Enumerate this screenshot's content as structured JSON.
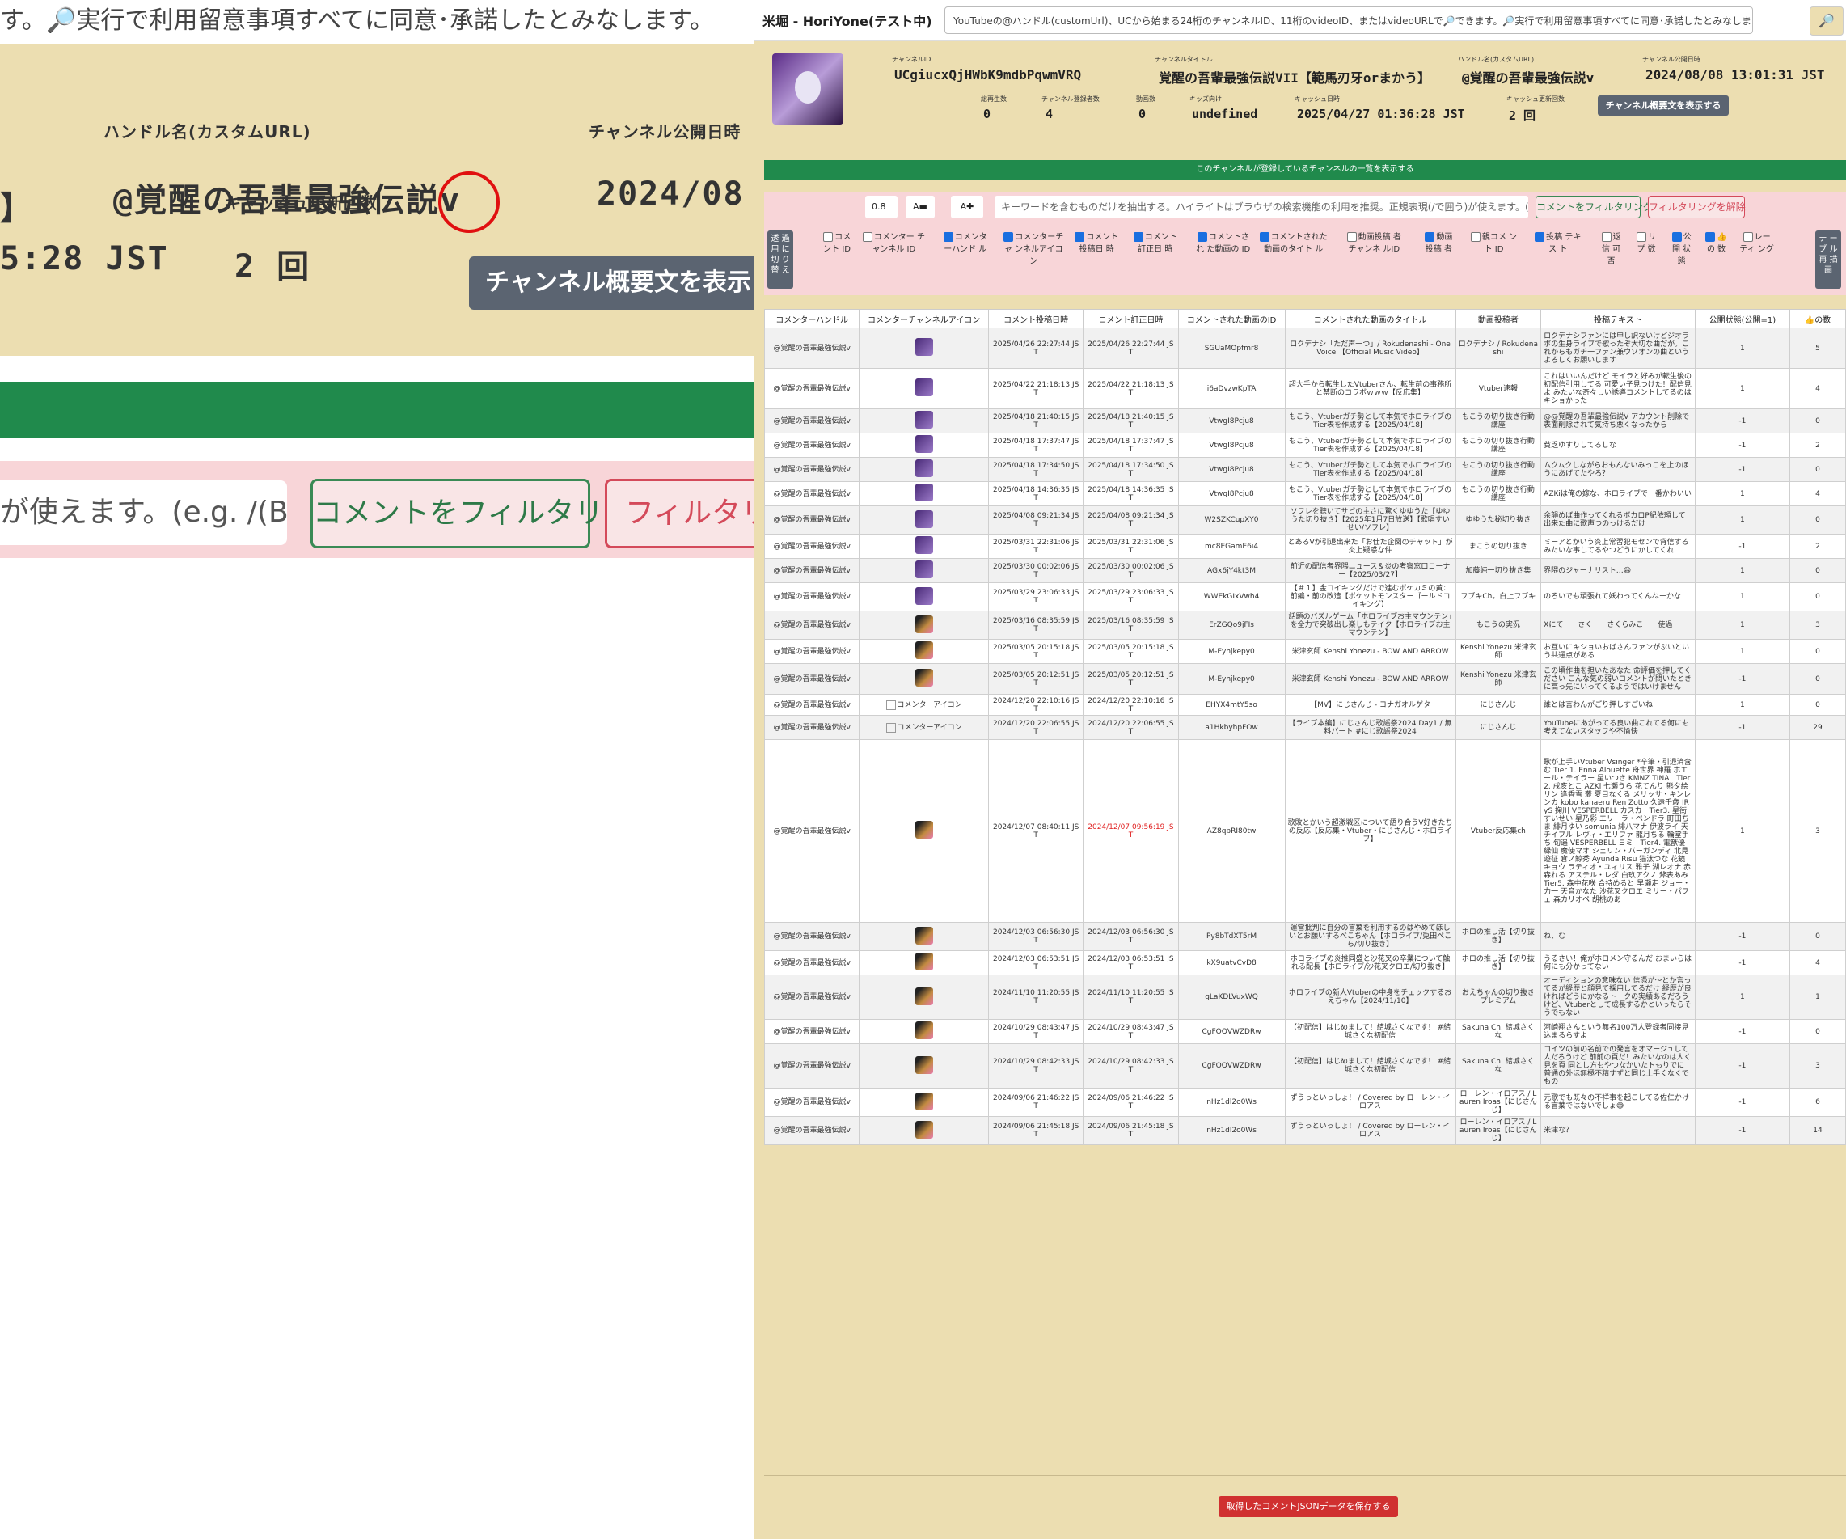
{
  "zoom": {
    "top_text": "す。🔎実行で利用留意事項すべてに同意･承諾したとみなします。",
    "handle_label": "ハンドル名(カスタムURL)",
    "handle_value": "@覚醒の吾輩最強伝説v",
    "published_label": "チャンネル公開日時",
    "published_value": "2024/08",
    "bracket": "】",
    "cache_time": "5:28 JST",
    "cache_count_label": "キャッシュ更新回数",
    "cache_count_value": "2 回",
    "desc_button": "チャンネル概要文を表示",
    "input_fragment": "が使えます。(e.g. /(BC|/",
    "filter_button": "コメントをフィルタリング",
    "clear_button": "フィルタリング"
  },
  "nav": {
    "brand": "米堀 - HoriYone(テスト中)",
    "search_placeholder": "YouTubeの@ハンドル(customUrl)、UCから始まる24桁のチャンネルID、11桁のvideoID、またはvideoURLで🔎できます。🔎実行で利用留意事項すべてに同意･承諾したとみなします。",
    "search_icon": "🔎"
  },
  "channel": {
    "id_label": "チャンネルID",
    "id_value": "UCgiucxQjHWbK9mdbPqwmVRQ",
    "title_label": "チャンネルタイトル",
    "title_value": "覚醒の吾輩最強伝説VII【範馬刃牙orまかう】",
    "handle_label": "ハンドル名(カスタムURL)",
    "handle_value": "@覚醒の吾輩最強伝説v",
    "published_label": "チャンネル公開日時",
    "published_value": "2024/08/08 13:01:31 JST",
    "views_label": "総再生数",
    "views_value": "0",
    "subs_label": "チャンネル登録者数",
    "subs_value": "4",
    "videos_label": "動画数",
    "videos_value": "0",
    "kids_label": "キッズ向け",
    "kids_value": "undefined",
    "cache_label": "キャッシュ日時",
    "cache_value": "2025/04/27 01:36:28 JST",
    "cache_count_label": "キャッシュ更新回数",
    "cache_count_value": "2 回",
    "desc_button": "チャンネル概要文を表示する"
  },
  "green_bar": "このチャンネルが登録しているチャンネルの一覧を表示する",
  "filter": {
    "font_size": "0.8",
    "shrink": "A▬",
    "grow": "A✚",
    "keyword_placeholder": "キーワードを含むものだけを抽出する。ハイライトはブラウザの検索機能の利用を推奨。正規表現(/で囲う)が使えます。(e.g. /(BC|/",
    "filter_button": "コメントをフィルタリング",
    "clear_button": "フィルタリングを解除",
    "transparent_toggle": "透 過 用 に 切 り 替 え",
    "table_redraw": "テ ー ブ ル 再 描 画"
  },
  "columns_toggle": [
    {
      "label": "コメ ント ID",
      "checked": false
    },
    {
      "label": "コメンター チャンネル ID",
      "checked": false
    },
    {
      "label": "コメンタ ーハンド ル",
      "checked": true
    },
    {
      "label": "コメンターチャ ンネルアイコ ン",
      "checked": true
    },
    {
      "label": "コメント 投稿日 時",
      "checked": true
    },
    {
      "label": "コメント 訂正日 時",
      "checked": true
    },
    {
      "label": "コメントされ た動画の ID",
      "checked": true
    },
    {
      "label": "コメントされた 動画のタイト ル",
      "checked": true
    },
    {
      "label": "動画投稿 者チャンネ ルID",
      "checked": false
    },
    {
      "label": "動画 投稿 者",
      "checked": true
    },
    {
      "label": "親コメ ント ID",
      "checked": false
    },
    {
      "label": "投稿 テキス ト",
      "checked": true
    },
    {
      "label": "返 信 可 否",
      "checked": false
    },
    {
      "label": "リ プ 数",
      "checked": false
    },
    {
      "label": "公 開 状 態",
      "checked": true
    },
    {
      "label": "👍 の 数",
      "checked": true
    },
    {
      "label": "レー ティ ング",
      "checked": false
    }
  ],
  "table": {
    "headers": [
      "コメンターハンドル",
      "コメンターチャンネルアイコン",
      "コメント投稿日時",
      "コメント訂正日時",
      "コメントされた動画のID",
      "コメントされた動画のタイトル",
      "動画投稿者",
      "投稿テキスト",
      "公開状態(公開=1)",
      "👍の数"
    ],
    "rows": [
      {
        "handle": "@覚醒の吾輩最強伝説v",
        "icon": "purple",
        "posted": "2025/04/26 22:27:44 JST",
        "edited": "2025/04/26 22:27:44 JST",
        "edited_red": false,
        "vid": "SGUaMOpfmr8",
        "title": "ロクデナシ「ただ声一つ」/ Rokudenashi - One Voice 【Official Music Video】",
        "uploader": "ロクデナシ / Rokudenashi",
        "text": "ロクデナシファンには申し訳ないけどジオラボの生身ライブで歌ったぞ大切な曲だが。これからもガチ一ファン兼ウソオンの曲というよろしくお願いします",
        "public": "1",
        "likes": "5"
      },
      {
        "handle": "@覚醒の吾輩最強伝説v",
        "icon": "purple",
        "posted": "2025/04/22 21:18:13 JST",
        "edited": "2025/04/22 21:18:13 JST",
        "edited_red": false,
        "vid": "i6aDvzwKpTA",
        "title": "超大手から転生したVtuberさん、転生前の事務所と禁断のコラボｗｗｗ【反応集】",
        "uploader": "Vtuber速報",
        "text": "これはいいんだけど モイラと好みが転生後の初配信引用してる 可愛い子見つけた！配信見よ みたいな奇々しい誘導コメントしてるのはキショかった",
        "public": "1",
        "likes": "4"
      },
      {
        "handle": "@覚醒の吾輩最強伝説v",
        "icon": "purple",
        "posted": "2025/04/18 21:40:15 JST",
        "edited": "2025/04/18 21:40:15 JST",
        "edited_red": false,
        "vid": "VtwgI8Pcju8",
        "title": "もこう、Vtuberガチ勢として本気でホロライブのTier表を作成する【2025/04/18】",
        "uploader": "もこうの切り抜き行動講座",
        "text": "@@覚醒の吾輩最強伝説V アカウント削除で表面削除されて気持ち悪くなったから",
        "public": "-1",
        "likes": "0"
      },
      {
        "handle": "@覚醒の吾輩最強伝説v",
        "icon": "purple",
        "posted": "2025/04/18 17:37:47 JST",
        "edited": "2025/04/18 17:37:47 JST",
        "edited_red": false,
        "vid": "VtwgI8Pcju8",
        "title": "もこう、Vtuberガチ勢として本気でホロライブのTier表を作成する【2025/04/18】",
        "uploader": "もこうの切り抜き行動講座",
        "text": "貧乏ゆすりしてるしな",
        "public": "-1",
        "likes": "2"
      },
      {
        "handle": "@覚醒の吾輩最強伝説v",
        "icon": "purple",
        "posted": "2025/04/18 17:34:50 JST",
        "edited": "2025/04/18 17:34:50 JST",
        "edited_red": false,
        "vid": "VtwgI8Pcju8",
        "title": "もこう、Vtuberガチ勢として本気でホロライブのTier表を作成する【2025/04/18】",
        "uploader": "もこうの切り抜き行動講座",
        "text": "ムクムクしながらおもんないみっこを上のほうにあげてたやろ？",
        "public": "-1",
        "likes": "0"
      },
      {
        "handle": "@覚醒の吾輩最強伝説v",
        "icon": "purple",
        "posted": "2025/04/18 14:36:35 JST",
        "edited": "2025/04/18 14:36:35 JST",
        "edited_red": false,
        "vid": "VtwgI8Pcju8",
        "title": "もこう、Vtuberガチ勢として本気でホロライブのTier表を作成する【2025/04/18】",
        "uploader": "もこうの切り抜き行動講座",
        "text": "AZKiは俺の嫁な、ホロライブで一番かわいい",
        "public": "1",
        "likes": "4"
      },
      {
        "handle": "@覚醒の吾輩最強伝説v",
        "icon": "purple",
        "posted": "2025/04/08 09:21:34 JST",
        "edited": "2025/04/08 09:21:34 JST",
        "edited_red": false,
        "vid": "W2SZKCupXY0",
        "title": "ソフレを聴いてサビの主さに驚くゆゆうた【ゆゆうた切り抜き】【2025年1月7日放送】【歌唱すいせい/ソフレ】",
        "uploader": "ゆゆうた秘切り抜き",
        "text": "余韻めば曲作ってくれるボカロP紀依頼して 出来た曲に歌声つのっけるだけ",
        "public": "1",
        "likes": "0"
      },
      {
        "handle": "@覚醒の吾輩最強伝説v",
        "icon": "purple",
        "posted": "2025/03/31 22:31:06 JST",
        "edited": "2025/03/31 22:31:06 JST",
        "edited_red": false,
        "vid": "mc8EGamE6i4",
        "title": "とあるVが引退出来た「お仕た企図のチャット」が炎上疑惑な件",
        "uploader": "まこうの切り抜き",
        "text": "ミーアとかいう炎上常習犯モセンで背信するみたいな事してるやつどうにかしてくれ",
        "public": "-1",
        "likes": "2"
      },
      {
        "handle": "@覚醒の吾輩最強伝説v",
        "icon": "purple",
        "posted": "2025/03/30 00:02:06 JST",
        "edited": "2025/03/30 00:02:06 JST",
        "edited_red": false,
        "vid": "AGx6jY4kt3M",
        "title": "前近の配信者界隈ニュース＆炎の考察窓口コーナー【2025/03/27】",
        "uploader": "加藤純一切り抜き集",
        "text": "界隈のジャーナリスト…😄",
        "public": "1",
        "likes": "0"
      },
      {
        "handle": "@覚醒の吾輩最強伝説v",
        "icon": "purple",
        "posted": "2025/03/29 23:06:33 JST",
        "edited": "2025/03/29 23:06:33 JST",
        "edited_red": false,
        "vid": "WWEkGIxVwh4",
        "title": "【＃１】金コイキングだけで進むポケカミの黄：前編・前の改造【ポケットモンスターゴールドコイキング】",
        "uploader": "フブキCh。白上フブキ",
        "text": "のろいでも頑張れて妖わってくんねーかな",
        "public": "1",
        "likes": "0"
      },
      {
        "handle": "@覚醒の吾輩最強伝説v",
        "icon": "blend",
        "posted": "2025/03/16 08:35:59 JST",
        "edited": "2025/03/16 08:35:59 JST",
        "edited_red": false,
        "vid": "ErZGQo9jFIs",
        "title": "話題のバズルゲーム「ホロライブお主マウンテン」を全力で突破出し楽しもテイク【ホロライブお主マウンテン】",
        "uploader": "もこうの実況",
        "text": "Xにて　　さく　　さくらみこ　　使過",
        "public": "1",
        "likes": "3"
      },
      {
        "handle": "@覚醒の吾輩最強伝説v",
        "icon": "blend",
        "posted": "2025/03/05 20:15:18 JST",
        "edited": "2025/03/05 20:15:18 JST",
        "edited_red": false,
        "vid": "M-Eyhjkepy0",
        "title": "米津玄師 Kenshi Yonezu - BOW AND ARROW",
        "uploader": "Kenshi Yonezu 米津玄師",
        "text": "お互いにキショいおばさんファンがぷいという共通点がある",
        "public": "1",
        "likes": "0"
      },
      {
        "handle": "@覚醒の吾輩最強伝説v",
        "icon": "blend",
        "posted": "2025/03/05 20:12:51 JST",
        "edited": "2025/03/05 20:12:51 JST",
        "edited_red": false,
        "vid": "M-Eyhjkepy0",
        "title": "米津玄師 Kenshi Yonezu - BOW AND ARROW",
        "uploader": "Kenshi Yonezu 米津玄師",
        "text": "この頃作曲を担いたあなた 命評価を押してください こんな気の弱いコメントが問いたときに高っ先にいってくるようではいけません",
        "public": "-1",
        "likes": "0"
      },
      {
        "handle": "@覚醒の吾輩最強伝説v",
        "icon": "broken",
        "posted": "2024/12/20 22:10:16 JST",
        "edited": "2024/12/20 22:10:16 JST",
        "edited_red": false,
        "vid": "EHYX4mtY5so",
        "title": "【MV】にじさんじ - ヨナガオルゲタ",
        "uploader": "にじさんじ",
        "text": "誰とは言わんがごり押しすごいね",
        "public": "1",
        "likes": "0"
      },
      {
        "handle": "@覚醒の吾輩最強伝説v",
        "icon": "broken",
        "posted": "2024/12/20 22:06:55 JST",
        "edited": "2024/12/20 22:06:55 JST",
        "edited_red": false,
        "vid": "a1HkbyhpFOw",
        "title": "【ライブ本編】にじさんじ歌謡祭2024 Day1 / 無料パート #にじ歌謡祭2024",
        "uploader": "にじさんじ",
        "text": "YouTubeにあがってる良い曲これてる何にも考えてないスタッフや不愉快",
        "public": "-1",
        "likes": "29"
      },
      {
        "handle": "@覚醒の吾輩最強伝説v",
        "icon": "blend",
        "posted": "2024/12/07 08:40:11 JST",
        "edited": "2024/12/07 09:56:19 JST",
        "edited_red": true,
        "vid": "AZ8qbRI80tw",
        "title": "歌敗とかいう超激戦区について語り合うV好きたちの反応【反応集・Vtuber・にじさんじ・ホロライブ】",
        "uploader": "Vtuber反応集ch",
        "text": "歌が上手いVtuber Vsinger *辛筆・引退済含む Tier 1. Enna Alouette 舟世界 神羅 ホエール・テイラー 星いつき KMNZ TINA　Tier 2. 戌亥とこ AZKi 七瀬うら 花てんり 熊夕絵リン 逢香雪 叢 夏目なくる メリッサ・キンレンカ kobo kanaeru Ren Zotto 久遠千歳 IRyS 掬川 VESPERBELL カスカ　Tier3. 星街すいせい 星乃彩 エリーラ・ペンドラ 町田ちま 緋月ゆい somunia 緋八マナ 伊波ライ 天チイブル レヴィ・エリファ 龍月ちる 輪堂手ち 旬遇 VESPERBELL ヨミ　Tier4. 電獣優 緑仙 魔使マオ シェリン・バーガンディ 北見遊征 倉ノ鯨秀 Ayunda Risu 猫汰つな 花鏡キョウ ラティオ・ユィリス 雅子 湖レオナ 赤森れる アステル・レダ 白玖アクノ 斧表あみ　Tier5. 森中花咲 合持めると 早瀬走 ジョー・力一 天音かなた 沙花叉クロエ ミリー・パフェ 森カリオペ 胡桃のあ",
        "public": "1",
        "likes": "3"
      },
      {
        "handle": "@覚醒の吾輩最強伝説v",
        "icon": "blend",
        "posted": "2024/12/03 06:56:30 JST",
        "edited": "2024/12/03 06:56:30 JST",
        "edited_red": false,
        "vid": "Py8bTdXT5rM",
        "title": "運営批判に自分の言葉を利用するのはやめてほしいとお願いするべこちゃん【ホロライブ/兎田ぺこら/切り抜き】",
        "uploader": "ホロの推し活【切り抜き】",
        "text": "ね、む",
        "public": "-1",
        "likes": "0"
      },
      {
        "handle": "@覚醒の吾輩最強伝説v",
        "icon": "blend",
        "posted": "2024/12/03 06:53:51 JST",
        "edited": "2024/12/03 06:53:51 JST",
        "edited_red": false,
        "vid": "kX9uatvCvD8",
        "title": "ホロライブの炎推同盛と沙花叉の卒業について触れる配長【ホロライブ/沙花叉クロエ/切り抜き】",
        "uploader": "ホロの推し活【切り抜き】",
        "text": "うるさい！俺がホロメン守るんだ おまいらは何にも分かってない",
        "public": "-1",
        "likes": "4"
      },
      {
        "handle": "@覚醒の吾輩最強伝説v",
        "icon": "blend",
        "posted": "2024/11/10 11:20:55 JST",
        "edited": "2024/11/10 11:20:55 JST",
        "edited_red": false,
        "vid": "gLaKDLVuxWQ",
        "title": "ホロライブの新人Vtuberの中身をチェックするおえちゃん【2024/11/10】",
        "uploader": "おえちゃんの切り抜き プレミアム",
        "text": "オーディションの意味ない 信憑が〜とか言ってるが経歴と顔見て採用してるだけ 経歴が良ければどうにかなるトークの実績あるだろうけど、Vtuberとして成長するかといったらそうでもない",
        "public": "1",
        "likes": "1"
      },
      {
        "handle": "@覚醒の吾輩最強伝説v",
        "icon": "blend",
        "posted": "2024/10/29 08:43:47 JST",
        "edited": "2024/10/29 08:43:47 JST",
        "edited_red": false,
        "vid": "CgFOQVWZDRw",
        "title": "【初配信】はじめまして！結城さくなです！ #結城さくな初配信",
        "uploader": "Sakuna Ch. 結城さくな",
        "text": "河崎翔さんという無名100万人登録者同接見込まるらすよ",
        "public": "-1",
        "likes": "0"
      },
      {
        "handle": "@覚醒の吾輩最強伝説v",
        "icon": "blend",
        "posted": "2024/10/29 08:42:33 JST",
        "edited": "2024/10/29 08:42:33 JST",
        "edited_red": false,
        "vid": "CgFOQVWZDRw",
        "title": "【初配信】はじめまして！結城さくなです！ #結城さくな初配信",
        "uploader": "Sakuna Ch. 結城さくな",
        "text": "コイツの前の名前での発言をオマージュして人だろうけど 前前の頁だ！みたいなのは人く見を頁 同とし方もやつなかいたトもりでに 普通の外ほ無極不精すずと同じ上手くなくでもの",
        "public": "-1",
        "likes": "3"
      },
      {
        "handle": "@覚醒の吾輩最強伝説v",
        "icon": "blend",
        "posted": "2024/09/06 21:46:22 JST",
        "edited": "2024/09/06 21:46:22 JST",
        "edited_red": false,
        "vid": "nHz1dl2o0Ws",
        "title": "ずうっといっしょ！ / Covered by ローレン・イロアス",
        "uploader": "ローレン・イロアス / Lauren Iroas【にじさんじ】",
        "text": "元歌でも既々の不祥事を起こしてる佐仁かける言葉ではないでしょ😅",
        "public": "-1",
        "likes": "6"
      },
      {
        "handle": "@覚醒の吾輩最強伝説v",
        "icon": "blend",
        "posted": "2024/09/06 21:45:18 JST",
        "edited": "2024/09/06 21:45:18 JST",
        "edited_red": false,
        "vid": "nHz1dl2o0Ws",
        "title": "ずうっといっしょ！ / Covered by ローレン・イロアス",
        "uploader": "ローレン・イロアス / Lauren Iroas【にじさんじ】",
        "text": "米津な？",
        "public": "-1",
        "likes": "14"
      }
    ]
  },
  "save_button": "取得したコメントJSONデータを保存する",
  "icon_alt": "コメンターアイコン"
}
